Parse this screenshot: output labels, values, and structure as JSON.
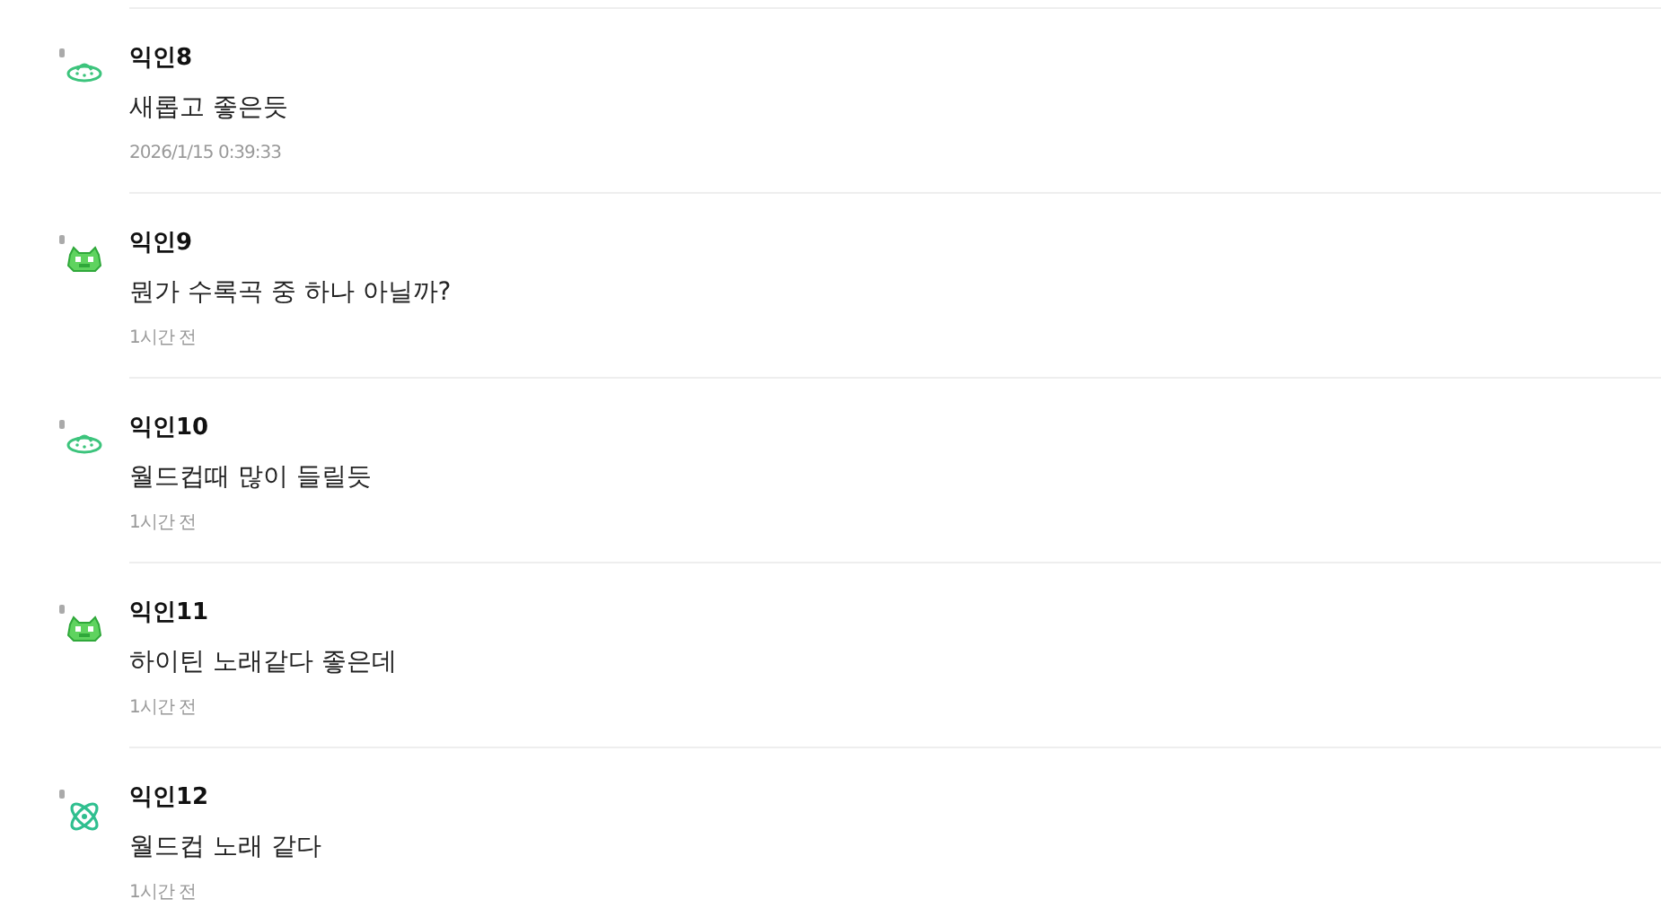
{
  "comments": [
    {
      "author": "익인8",
      "avatar": {
        "kind": "ufo"
      },
      "text": "새롭고 좋은듯",
      "time": "2026/1/15 0:39:33"
    },
    {
      "author": "익인9",
      "avatar": {
        "kind": "monster"
      },
      "text": "뭔가 수록곡 중 하나 아닐까?",
      "time": "1시간 전"
    },
    {
      "author": "익인10",
      "avatar": {
        "kind": "ufo"
      },
      "text": "월드컵때 많이 들릴듯",
      "time": "1시간 전"
    },
    {
      "author": "익인11",
      "avatar": {
        "kind": "monster"
      },
      "text": "하이틴 노래같다 좋은데",
      "time": "1시간 전"
    },
    {
      "author": "익인12",
      "avatar": {
        "kind": "atom"
      },
      "text": "월드컵 노래 같다",
      "time": "1시간 전"
    }
  ]
}
